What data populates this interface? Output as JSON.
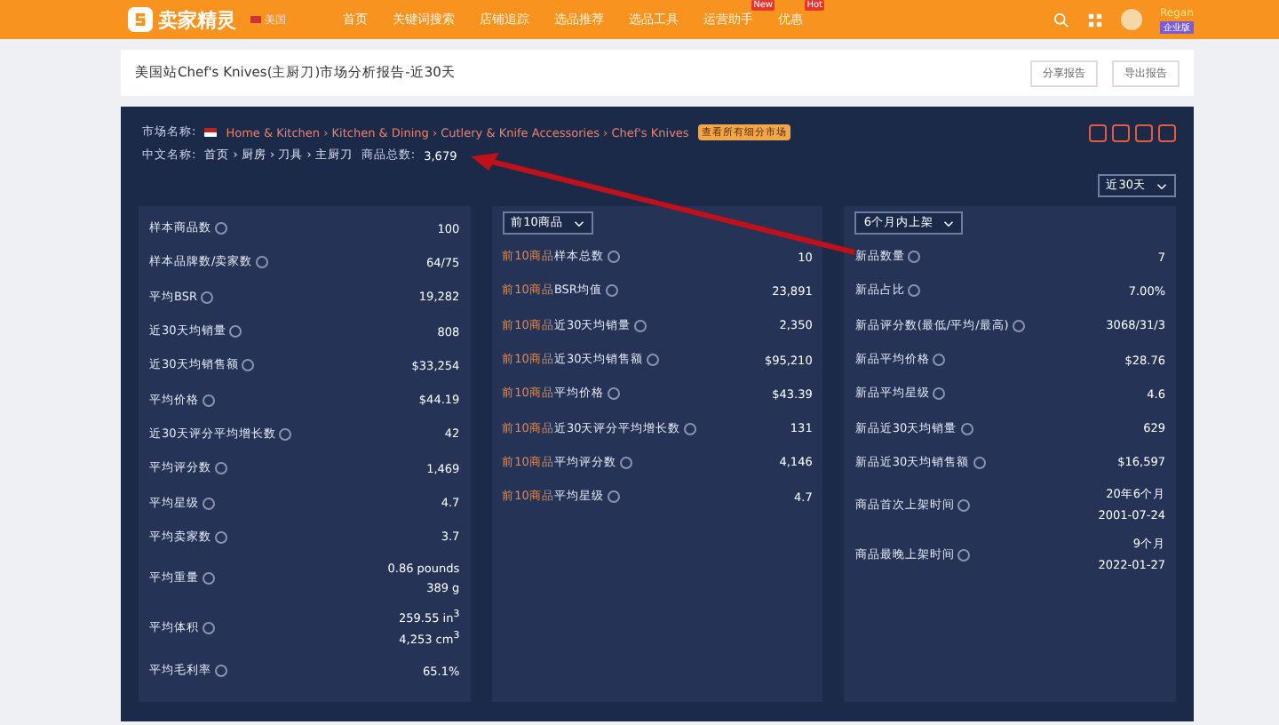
{
  "top_bar": {
    "logo": "卖家精灵",
    "site": "美国",
    "nav": [
      {
        "label": "首页"
      },
      {
        "label": "关键词搜索"
      },
      {
        "label": "店铺追踪"
      },
      {
        "label": "选品推荐"
      },
      {
        "label": "选品工具"
      },
      {
        "label": "运营助手",
        "badge": "New"
      },
      {
        "label": "优惠",
        "badge": "Hot"
      }
    ],
    "user": {
      "name": "Regan",
      "plan": "企业版"
    }
  },
  "report": {
    "title": "美国站Chef's Knives(主厨刀)市场分析报告-近30天",
    "buttons": [
      "分享报告",
      "导出报告"
    ]
  },
  "market": {
    "label": "市场名称:",
    "path": "Home & Kitchen › Kitchen & Dining › Cutlery & Knife Accessories › Chef's Knives",
    "tag": "查看所有细分市场",
    "cn_label": "中文名称:",
    "cn_path": "首页 › 厨房 › 刀具 › 主厨刀",
    "total_label": "商品总数:",
    "total": "3,679",
    "period": "近30天"
  },
  "columns": [
    {
      "rows": [
        {
          "label": "样本商品数",
          "value": [
            "100"
          ]
        },
        {
          "label": "样本品牌数/卖家数",
          "value": [
            "64/75"
          ]
        },
        {
          "label": "平均BSR",
          "value": [
            "19,282"
          ]
        },
        {
          "label": "近30天均销量",
          "value": [
            "808"
          ]
        },
        {
          "label": "近30天均销售额",
          "value": [
            "$33,254"
          ]
        },
        {
          "label": "平均价格",
          "value": [
            "$44.19"
          ]
        },
        {
          "label": "近30天评分平均增长数",
          "value": [
            "42"
          ]
        },
        {
          "label": "平均评分数",
          "value": [
            "1,469"
          ]
        },
        {
          "label": "平均星级",
          "value": [
            "4.7"
          ]
        },
        {
          "label": "平均卖家数",
          "value": [
            "3.7"
          ]
        },
        {
          "label": "平均重量",
          "value": [
            "0.86 pounds",
            "389 g"
          ]
        },
        {
          "label": "平均体积",
          "value": [
            "259.55 in$^{3}$",
            "4,253 cm$^{3}$"
          ]
        },
        {
          "label": "平均毛利率",
          "value": [
            "65.1%"
          ]
        }
      ]
    },
    {
      "selector": "前10商品",
      "rows": [
        {
          "prefix": "前10商品",
          "label": "样本总数",
          "value": [
            "10"
          ]
        },
        {
          "prefix": "前10商品",
          "label": "BSR均值",
          "value": [
            "23,891"
          ]
        },
        {
          "prefix": "前10商品",
          "label": "近30天均销量",
          "value": [
            "2,350"
          ]
        },
        {
          "prefix": "前10商品",
          "label": "近30天均销售额",
          "value": [
            "$95,210"
          ]
        },
        {
          "prefix": "前10商品",
          "label": "平均价格",
          "value": [
            "$43.39"
          ]
        },
        {
          "prefix": "前10商品",
          "label": "近30天评分平均增长数",
          "value": [
            "131"
          ]
        },
        {
          "prefix": "前10商品",
          "label": "平均评分数",
          "value": [
            "4,146"
          ]
        },
        {
          "prefix": "前10商品",
          "label": "平均星级",
          "value": [
            "4.7"
          ]
        }
      ]
    },
    {
      "selector": "6个月内上架",
      "rows": [
        {
          "label": "新品数量",
          "value": [
            "7"
          ]
        },
        {
          "label": "新品占比",
          "value": [
            "7.00%"
          ]
        },
        {
          "label": "新品评分数(最低/平均/最高)",
          "value": [
            "3068/31/3"
          ]
        },
        {
          "label": "新品平均价格",
          "value": [
            "$28.76"
          ]
        },
        {
          "label": "新品平均星级",
          "value": [
            "4.6"
          ]
        },
        {
          "label": "新品近30天均销量",
          "value": [
            "629"
          ]
        },
        {
          "label": "新品近30天均销售额",
          "value": [
            "$16,597"
          ]
        },
        {
          "label": "商品首次上架时间",
          "value": [
            "20年6个月",
            "2001-07-24"
          ]
        },
        {
          "label": "商品最晚上架时间",
          "value": [
            "9个月",
            "2022-01-27"
          ]
        }
      ]
    }
  ]
}
